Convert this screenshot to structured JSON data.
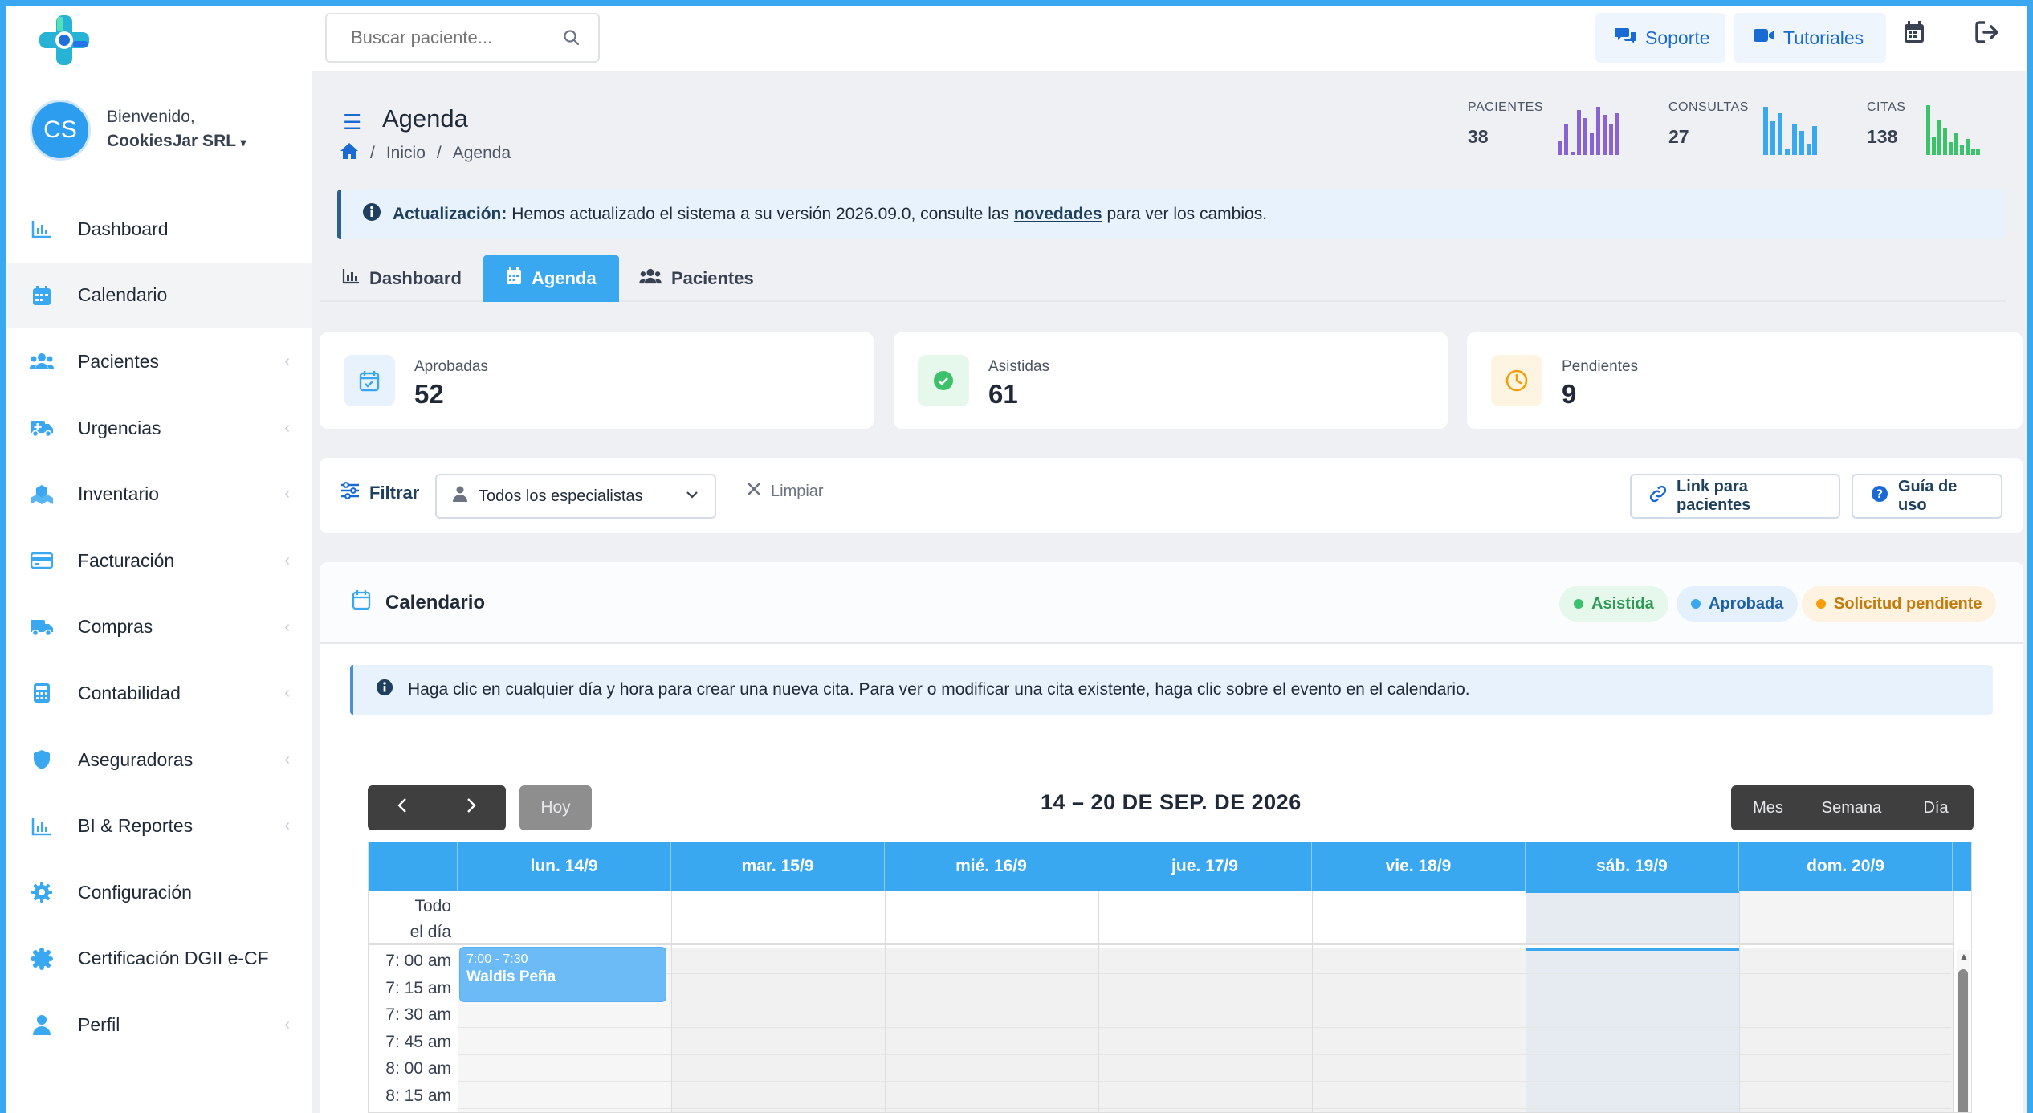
{
  "topbar": {
    "search_placeholder": "Buscar paciente...",
    "support_label": "Soporte",
    "tutorials_label": "Tutoriales"
  },
  "user": {
    "initials": "CS",
    "welcome": "Bienvenido,",
    "name": "CookiesJar SRL"
  },
  "sidebar": {
    "items": [
      {
        "label": "Dashboard",
        "icon": "chart-bar-icon",
        "has_chevron": false
      },
      {
        "label": "Calendario",
        "icon": "calendar-icon",
        "has_chevron": false,
        "active": true
      },
      {
        "label": "Pacientes",
        "icon": "users-icon",
        "has_chevron": true
      },
      {
        "label": "Urgencias",
        "icon": "ambulance-icon",
        "has_chevron": true
      },
      {
        "label": "Inventario",
        "icon": "boxes-icon",
        "has_chevron": true
      },
      {
        "label": "Facturación",
        "icon": "credit-card-icon",
        "has_chevron": true
      },
      {
        "label": "Compras",
        "icon": "truck-icon",
        "has_chevron": true
      },
      {
        "label": "Contabilidad",
        "icon": "calculator-icon",
        "has_chevron": true
      },
      {
        "label": "Aseguradoras",
        "icon": "shield-icon",
        "has_chevron": true
      },
      {
        "label": "BI & Reportes",
        "icon": "chart-bar-icon",
        "has_chevron": true
      },
      {
        "label": "Configuración",
        "icon": "gear-icon",
        "has_chevron": false
      },
      {
        "label": "Certificación DGII e-CF",
        "icon": "certificate-icon",
        "has_chevron": false
      },
      {
        "label": "Perfil",
        "icon": "user-icon",
        "has_chevron": true
      }
    ]
  },
  "page": {
    "title": "Agenda",
    "breadcrumb": [
      "Inicio",
      "Agenda"
    ]
  },
  "stats": [
    {
      "label": "PACIENTES",
      "value": "38",
      "color": "#8a63d2"
    },
    {
      "label": "CONSULTAS",
      "value": "27",
      "color": "#3aa8f0"
    },
    {
      "label": "CITAS",
      "value": "138",
      "color": "#3cc26a"
    }
  ],
  "alert": {
    "strong": "Actualización:",
    "text_before": "Hemos actualizado el sistema a su versión 2026.09.0, consulte las",
    "link": "novedades",
    "text_after": "para ver los cambios."
  },
  "tabs": [
    {
      "label": "Dashboard"
    },
    {
      "label": "Agenda",
      "active": true
    },
    {
      "label": "Pacientes"
    }
  ],
  "cards": [
    {
      "label": "Aprobadas",
      "value": "52"
    },
    {
      "label": "Asistidas",
      "value": "61"
    },
    {
      "label": "Pendientes",
      "value": "9"
    }
  ],
  "filter": {
    "label": "Filtrar",
    "select_value": "Todos los especialistas",
    "clear_label": "Limpiar",
    "link_label": "Link para pacientes",
    "guide_label": "Guía de uso"
  },
  "calendar": {
    "title": "Calendario",
    "legend": [
      {
        "label": "Asistida",
        "color": "#3cc26a"
      },
      {
        "label": "Aprobada",
        "color": "#3aa8f0"
      },
      {
        "label": "Solicitud pendiente",
        "color": "#f59e0b"
      }
    ],
    "info": "Haga clic en cualquier día y hora para crear una nueva cita. Para ver o modificar una cita existente, haga clic sobre el evento en el calendario.",
    "range_title": "14 – 20 DE SEP. DE 2026",
    "today_label": "Hoy",
    "views": [
      "Mes",
      "Semana",
      "Día"
    ],
    "days": [
      "lun. 14/9",
      "mar. 15/9",
      "mié. 16/9",
      "jue. 17/9",
      "vie. 18/9",
      "sáb. 19/9",
      "dom. 20/9"
    ],
    "all_day_label_1": "Todo",
    "all_day_label_2": "el día",
    "times": [
      "7: 00 am",
      "7: 15 am",
      "7: 30 am",
      "7: 45 am",
      "8: 00 am",
      "8: 15 am"
    ],
    "event": {
      "time": "7:00 - 7:30",
      "name": "Waldis Peña"
    }
  }
}
